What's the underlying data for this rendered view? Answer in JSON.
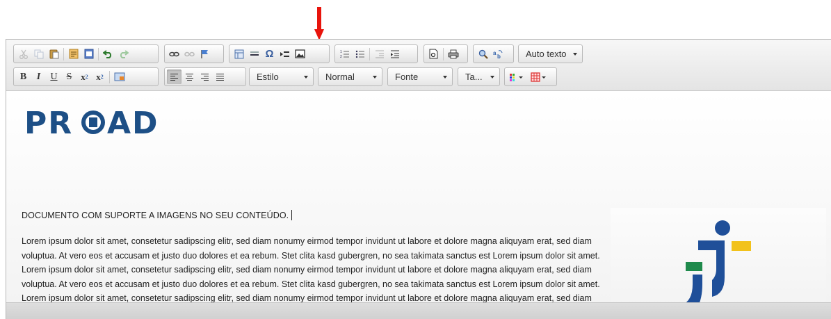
{
  "toolbar": {
    "row1": {
      "clipboard": [
        "cut-icon",
        "copy-icon",
        "paste-icon",
        "paste-text-icon",
        "paste-word-icon"
      ],
      "history": [
        "undo-icon",
        "redo-icon"
      ],
      "links": [
        "link-icon",
        "unlink-icon",
        "anchor-icon"
      ],
      "insert": [
        "table-icon",
        "horizontal-line-icon",
        "special-char-icon",
        "page-break-icon",
        "image-icon"
      ],
      "special_char_glyph": "Ω",
      "lists": [
        "numbered-list-icon",
        "bulleted-list-icon",
        "outdent-icon",
        "indent-icon"
      ],
      "doc": [
        "preview-icon",
        "print-icon"
      ],
      "find": [
        "find-icon",
        "replace-icon"
      ],
      "autotext_label": "Auto texto"
    },
    "row2": {
      "format_buttons": [
        {
          "name": "bold-button",
          "label": "B"
        },
        {
          "name": "italic-button",
          "label": "I"
        },
        {
          "name": "underline-button",
          "label": "U"
        },
        {
          "name": "strikethrough-button",
          "label": "S"
        },
        {
          "name": "subscript-button",
          "label": "x"
        },
        {
          "name": "superscript-button",
          "label": "x"
        }
      ],
      "style_label": "Estilo",
      "format_label": "Normal",
      "font_label": "Fonte",
      "size_label": "Ta..."
    }
  },
  "content": {
    "logo_text": "PROAD",
    "heading": "DOCUMENTO COM SUPORTE A IMAGENS NO SEU CONTEÚDO.",
    "paragraph": "Lorem ipsum dolor sit amet, consetetur sadipscing elitr, sed diam nonumy eirmod tempor invidunt ut labore et dolore magna aliquyam erat, sed diam voluptua. At vero eos et accusam et justo duo dolores et ea rebum. Stet clita kasd gubergren, no sea takimata sanctus est Lorem ipsum dolor sit amet. Lorem ipsum dolor sit amet, consetetur sadipscing elitr, sed diam nonumy eirmod tempor invidunt ut labore et dolore magna aliquyam erat, sed diam voluptua. At vero eos et accusam et justo duo dolores et ea rebum. Stet clita kasd gubergren, no sea takimata sanctus est Lorem ipsum dolor sit amet. Lorem ipsum dolor sit amet, consetetur sadipscing elitr, sed diam nonumy eirmod tempor invidunt ut labore et dolore magna aliquyam erat, sed diam voluptua. At vero eos et accusam et justo duo dolores et ea rebum. Stet clita kasd gubergren, no sea takimata sanctus est Lorem ipsum dolor sit amet."
  },
  "colors": {
    "arrow": "#e8140c",
    "logo_blue": "#1d4f86",
    "jt_blue": "#1f4f99",
    "jt_green": "#1f8a4c",
    "jt_yellow": "#f2c21b"
  }
}
